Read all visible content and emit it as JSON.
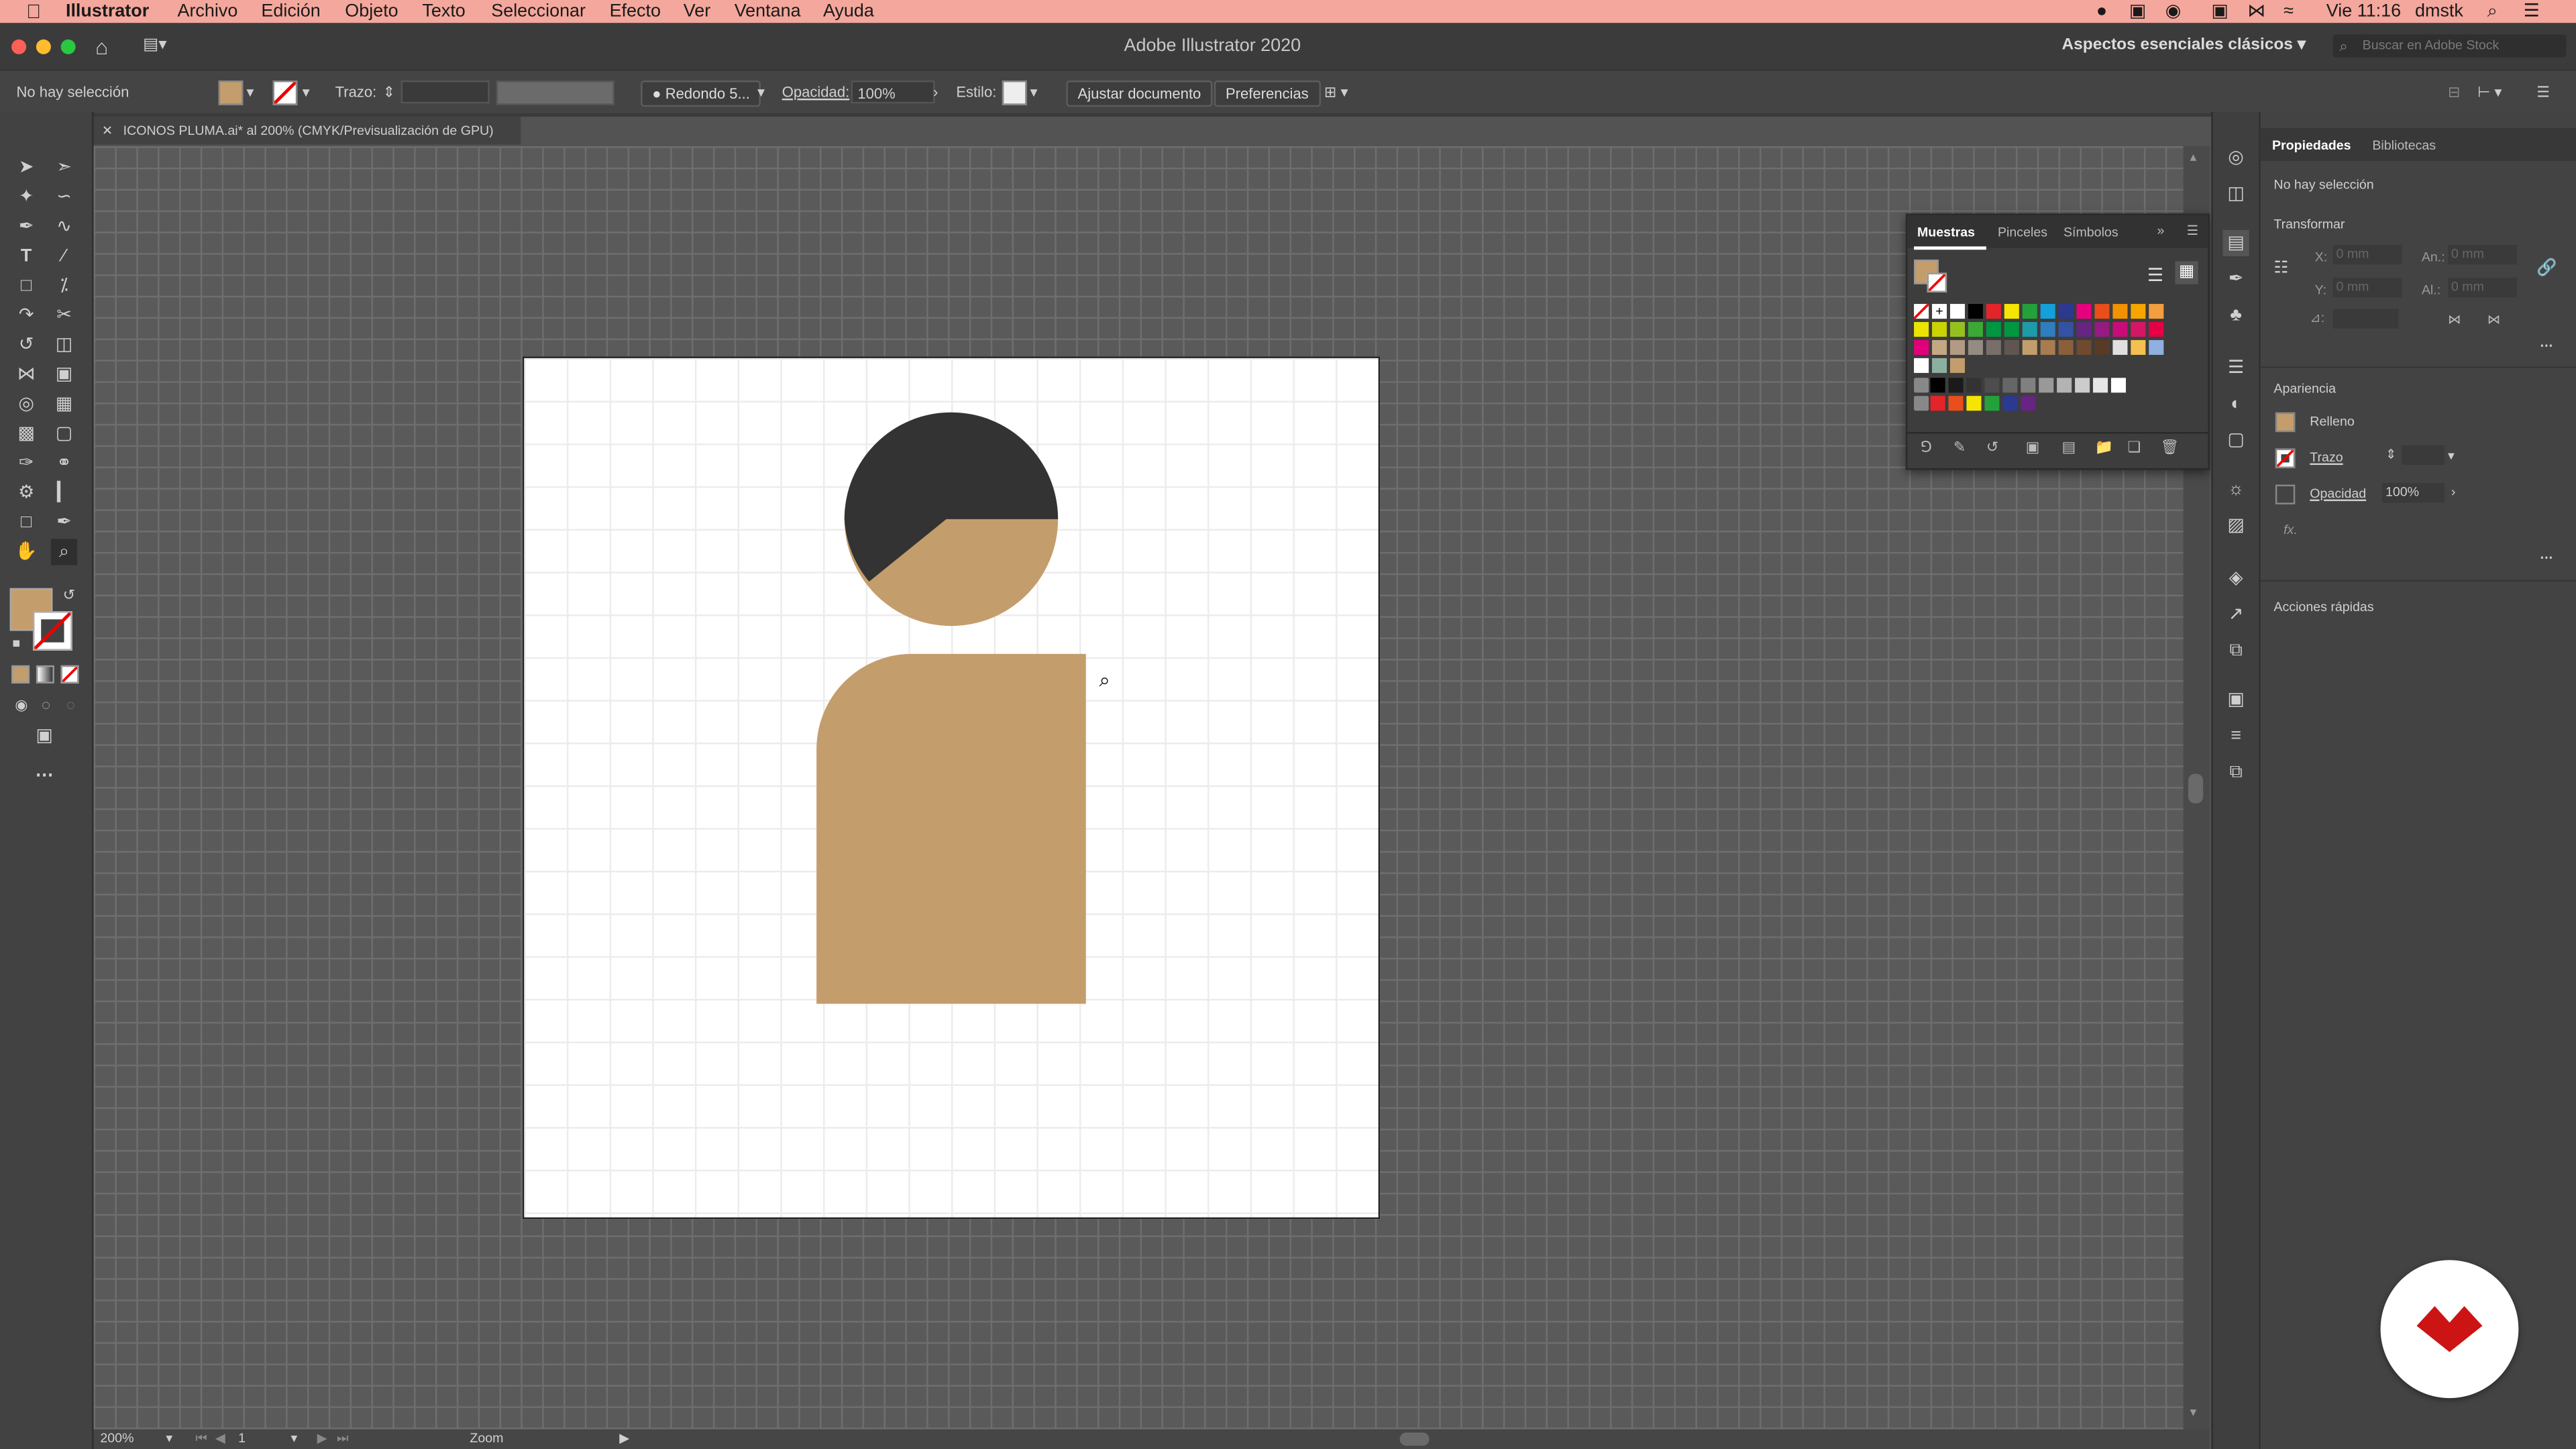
{
  "menubar": {
    "apple_icon": "apple-icon",
    "app_name": "Illustrator",
    "items": [
      "Archivo",
      "Edición",
      "Objeto",
      "Texto",
      "Seleccionar",
      "Efecto",
      "Ver",
      "Ventana",
      "Ayuda"
    ],
    "clock": "Vie 11:16",
    "user": "dmstk",
    "bg_color": "#f4a79c"
  },
  "window": {
    "title": "Adobe Illustrator 2020",
    "workspace": "Aspectos esenciales clásicos",
    "stock_search_placeholder": "Buscar en Adobe Stock"
  },
  "control_bar": {
    "selection_status": "No hay selección",
    "stroke_label": "Trazo:",
    "brush_label": "Redondo 5...",
    "opacity_label": "Opacidad:",
    "opacity_value": "100%",
    "style_label": "Estilo:",
    "fit_document_button": "Ajustar documento",
    "preferences_button": "Preferencias"
  },
  "document": {
    "tab_title": "ICONOS PLUMA.ai* al 200% (CMYK/Previsualización de GPU)",
    "zoom": "200%",
    "artboard_number": "1",
    "status_tool": "Zoom"
  },
  "artwork": {
    "fill_color": "#c49d6c",
    "dark_color": "#333333"
  },
  "swatches_panel": {
    "tabs": [
      "Muestras",
      "Pinceles",
      "Símbolos"
    ],
    "active_tab": "Muestras"
  },
  "properties_panel": {
    "tabs": [
      "Propiedades",
      "Bibliotecas"
    ],
    "no_selection": "No hay selección",
    "transform_title": "Transformar",
    "x_label": "X:",
    "y_label": "Y:",
    "w_label": "An.:",
    "h_label": "Al.:",
    "x_value": "0 mm",
    "y_value": "0 mm",
    "w_value": "0 mm",
    "h_value": "0 mm",
    "angle_label": "⊿:",
    "appearance_title": "Apariencia",
    "fill_label": "Relleno",
    "stroke_label": "Trazo",
    "opacity_label": "Opacidad",
    "opacity_value": "100%",
    "fx_label": "fx.",
    "quick_actions_title": "Acciones rápidas"
  }
}
